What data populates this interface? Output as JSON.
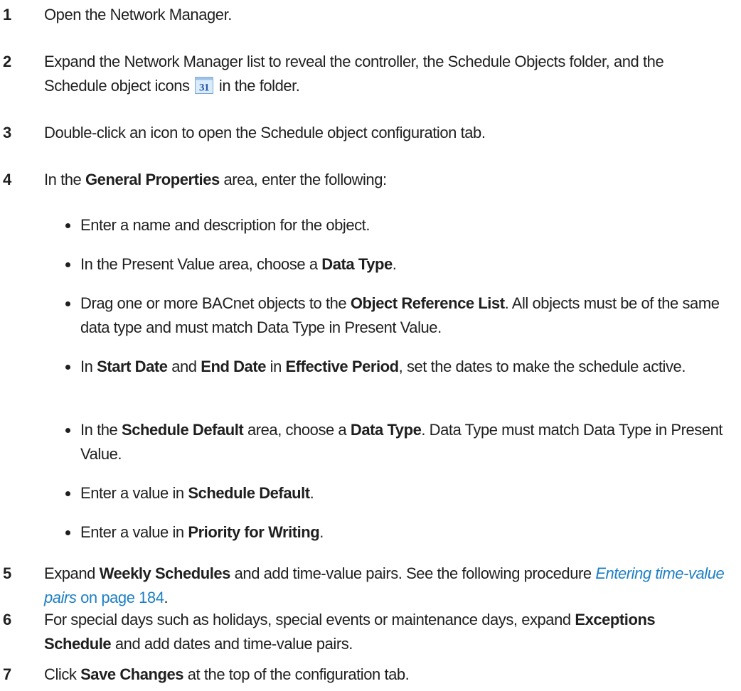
{
  "steps": [
    {
      "number": "1",
      "parts": [
        {
          "t": "Open the Network Manager."
        }
      ]
    },
    {
      "number": "2",
      "parts": [
        {
          "t": "Expand the Network Manager list to reveal the controller, the Schedule Objects folder, and the Schedule object icons "
        },
        {
          "icon": "calendar-31-icon",
          "icon_text": "31"
        },
        {
          "t": " in the folder."
        }
      ]
    },
    {
      "number": "3",
      "parts": [
        {
          "t": "Double-click an icon to open the Schedule object configuration tab."
        }
      ]
    },
    {
      "number": "4",
      "parts": [
        {
          "t": "In the "
        },
        {
          "b": "General Properties"
        },
        {
          "t": " area, enter the following:"
        }
      ],
      "bullets": [
        [
          {
            "t": "Enter a name and description for the object."
          }
        ],
        [
          {
            "t": "In the Present Value area, choose a "
          },
          {
            "b": "Data Type"
          },
          {
            "t": "."
          }
        ],
        [
          {
            "t": "Drag one or more BACnet objects to the "
          },
          {
            "b": "Object Reference List"
          },
          {
            "t": ". All objects must be of the same data type and must match Data Type in Present Value."
          }
        ],
        [
          {
            "t": "In "
          },
          {
            "b": "Start Date"
          },
          {
            "t": " and "
          },
          {
            "b": "End Date"
          },
          {
            "t": " in "
          },
          {
            "b": "Effective Period"
          },
          {
            "t": ", set the dates to make the schedule active."
          }
        ],
        [
          {
            "t": "In the "
          },
          {
            "b": "Schedule Default"
          },
          {
            "t": " area, choose a "
          },
          {
            "b": "Data Type"
          },
          {
            "t": ". Data Type must match Data Type in Present Value."
          }
        ],
        [
          {
            "t": "Enter a value in "
          },
          {
            "b": "Schedule Default"
          },
          {
            "t": "."
          }
        ],
        [
          {
            "t": "Enter a value in "
          },
          {
            "b": "Priority for Writing"
          },
          {
            "t": "."
          }
        ]
      ]
    },
    {
      "number": "5",
      "parts": [
        {
          "t": "Expand "
        },
        {
          "b": "Weekly Schedules"
        },
        {
          "t": " and add time-value pairs. See the following procedure "
        },
        {
          "link_title": "Entering time-value pairs",
          "link_page": " on page 184"
        },
        {
          "t": "."
        }
      ]
    },
    {
      "number": "6",
      "parts": [
        {
          "t": "For special days such as holidays, special events or maintenance days, expand "
        },
        {
          "b": "Exceptions Schedule"
        },
        {
          "t": " and add dates and time-value pairs."
        }
      ]
    },
    {
      "number": "7",
      "parts": [
        {
          "t": "Click "
        },
        {
          "b": "Save Changes"
        },
        {
          "t": " at the top of the configuration tab."
        }
      ]
    }
  ],
  "colors": {
    "text": "#1f1f1f",
    "link": "#1d7fc4",
    "icon_bg": "#d9ecfb",
    "icon_text": "#2a57a8"
  }
}
